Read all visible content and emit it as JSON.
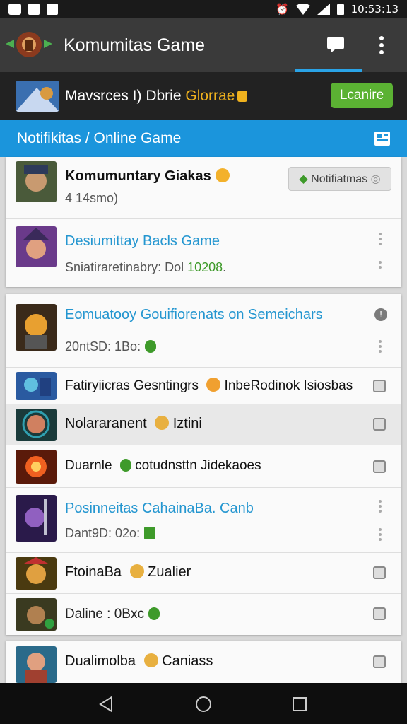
{
  "status_bar": {
    "time": "10:53:13"
  },
  "app_bar": {
    "title": "Komumitas Game"
  },
  "banner": {
    "text_main": "Mavsrces I) Dbrie ",
    "text_gold": "Glorrae",
    "cta_label": "Lcanire"
  },
  "sub_header": {
    "title": "Notifikitas / Online Game"
  },
  "cards": [
    {
      "rows": [
        {
          "title": "Komumuntary Giakas",
          "subtitle": "4 14smo)",
          "chip": "Notifiatmas"
        },
        {
          "title": "Desiumittay Bacls Game",
          "subtitle": "Sniatiraretinabry: Dol ",
          "subtitle_green": "10208",
          "subtitle_tail": "."
        }
      ]
    },
    {
      "rows": [
        {
          "title": "Eomuatooy Gouifiorenats on Semeichars",
          "subtitle": "20ntSD: 1Bo:"
        },
        {
          "title": "Fatiryiicras Gesntingrs ",
          "title_tail": " InbeRodinok Isiosbas"
        },
        {
          "title": "Nolararanent ",
          "title_tail": " Iztini"
        },
        {
          "title": "Duarnle ",
          "title_tail": " cotudnsttn Jidekaoes"
        },
        {
          "title": "Posinneitas CahainaBa. Canb",
          "subtitle": "Dant9D: 02o:"
        },
        {
          "title": "FtoinaBa ",
          "title_tail": " Zualier"
        },
        {
          "title": "Daline : 0Bxc"
        }
      ]
    },
    {
      "rows": [
        {
          "title": "Dualimolba ",
          "title_tail": " Caniass"
        }
      ]
    }
  ],
  "colors": {
    "primary": "#1b95dc",
    "accent_green": "#5bb233",
    "gold": "#f0b21e",
    "link_blue": "#2496d0"
  }
}
